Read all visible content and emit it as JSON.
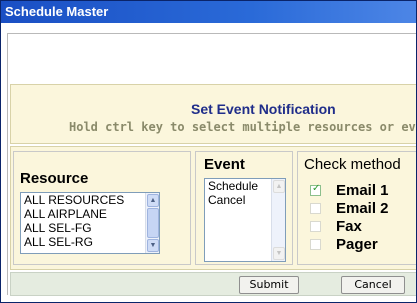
{
  "window": {
    "title": "Schedule Master"
  },
  "notification": {
    "title": "Set Event Notification",
    "subtitle": "Hold ctrl key to select multiple resources or events"
  },
  "resource": {
    "label": "Resource",
    "items": [
      "ALL RESOURCES",
      "ALL AIRPLANE",
      "ALL SEL-FG",
      "ALL SEL-RG"
    ]
  },
  "event": {
    "label": "Event",
    "items": [
      "Schedule",
      "Cancel"
    ]
  },
  "method": {
    "label": "Check method",
    "options": [
      {
        "label": "Email 1",
        "checked": true
      },
      {
        "label": "Email 2",
        "checked": false
      },
      {
        "label": "Fax",
        "checked": false
      },
      {
        "label": "Pager",
        "checked": false
      }
    ]
  },
  "actions": {
    "submit_label": "Submit",
    "cancel_label": "Cancel"
  }
}
